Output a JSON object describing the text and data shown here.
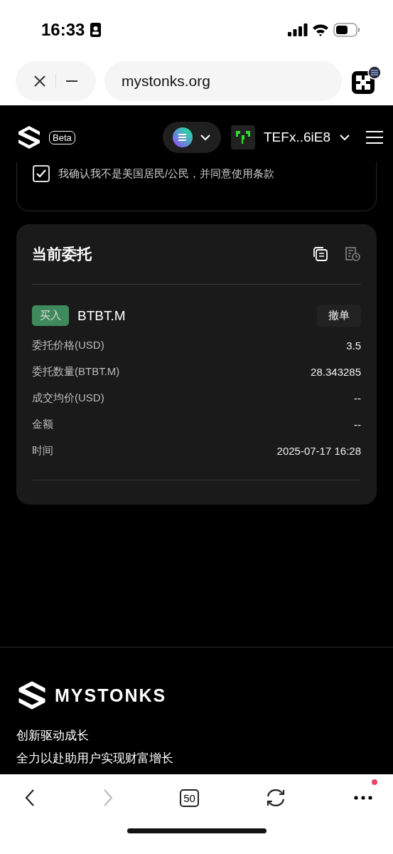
{
  "status_bar": {
    "time": "16:33"
  },
  "browser": {
    "url": "mystonks.org",
    "tab_count": "50",
    "forward_disabled": true,
    "menu_badge": true
  },
  "header": {
    "beta": "Beta",
    "wallet": "TEFx..6iE8"
  },
  "terms": {
    "text": "我确认我不是美国居民/公民，并同意使用条款",
    "checked": true
  },
  "orders": {
    "title": "当前委托",
    "items": [
      {
        "color": "#3f8a5c",
        "side_label": "买入",
        "symbol": "BTBT.M",
        "cancel": "撤单",
        "fields": [
          {
            "label": "委托价格(USD)",
            "value": "3.5"
          },
          {
            "label": "委托数量(BTBT.M)",
            "value": "28.343285"
          },
          {
            "label": "成交均价(USD)",
            "value": "--"
          },
          {
            "label": "金额",
            "value": "--"
          },
          {
            "label": "时间",
            "value": "2025-07-17 16:28"
          }
        ]
      }
    ]
  },
  "footer": {
    "brand": "MYSTONKS",
    "taglines": [
      "创新驱动成长",
      "全力以赴助用户实现财富增长"
    ]
  }
}
